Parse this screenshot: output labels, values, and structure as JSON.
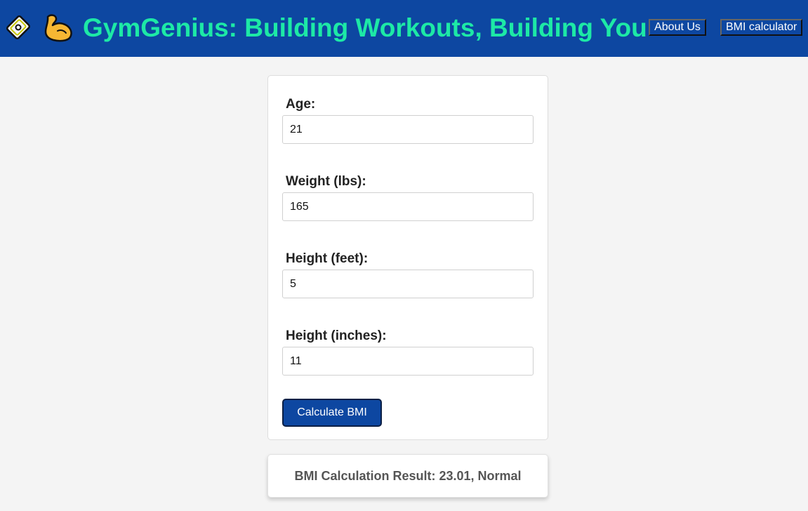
{
  "header": {
    "title": "GymGenius: Building Workouts, Building You",
    "logo_icon": "badge-icon",
    "muscle_icon": "flexed-biceps-icon",
    "nav": {
      "about_label": "About Us",
      "bmi_label": "BMI calculator"
    }
  },
  "colors": {
    "header_bg": "#0d47a1",
    "title": "#1de9a6",
    "page_bg": "#f4f4f4",
    "button_bg": "#0d47a1"
  },
  "form": {
    "fields": [
      {
        "label": "Age:",
        "value": "21"
      },
      {
        "label": "Weight (lbs):",
        "value": "165"
      },
      {
        "label": "Height (feet):",
        "value": "5"
      },
      {
        "label": "Height (inches):",
        "value": "11"
      }
    ],
    "submit_label": "Calculate BMI"
  },
  "result": {
    "text": "BMI Calculation Result: 23.01, Normal"
  }
}
